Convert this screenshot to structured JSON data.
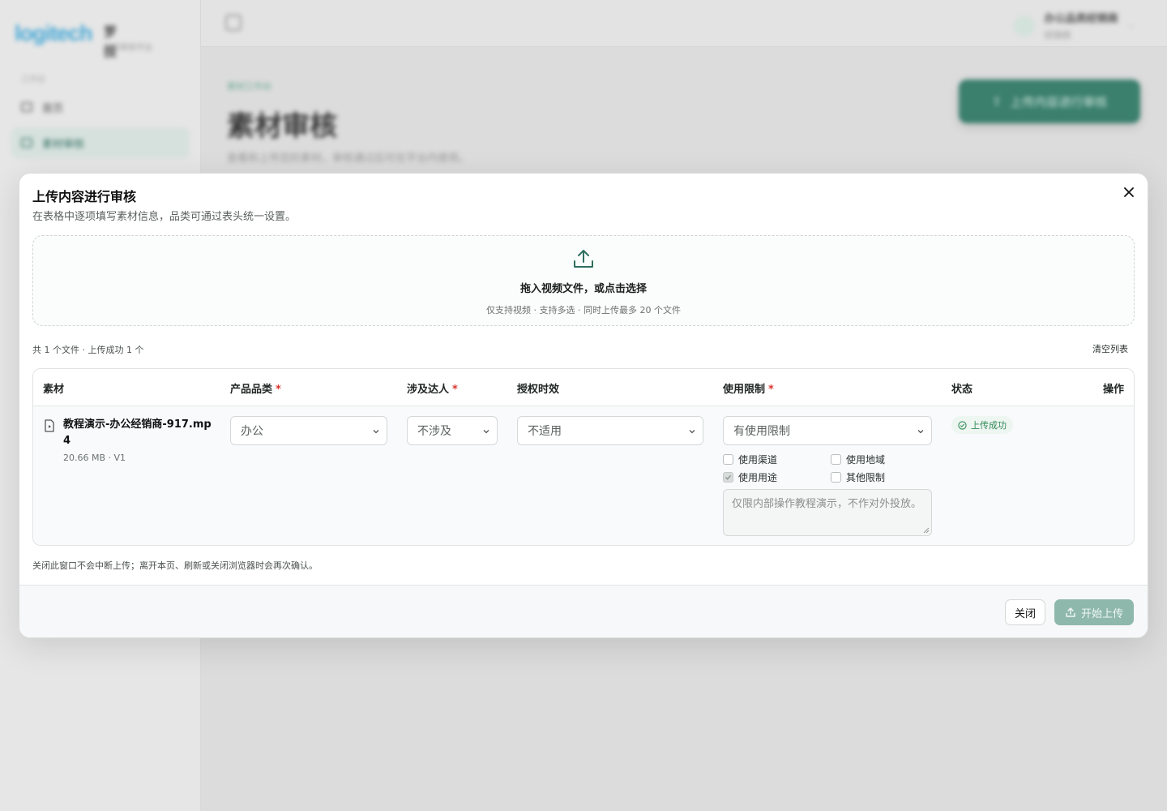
{
  "background": {
    "logo": "logitech",
    "brand": "罗 技",
    "brand_sub": "内容审核平台",
    "nav_group": "工作台",
    "nav": [
      {
        "label": "首页"
      },
      {
        "label": "素材审核"
      }
    ],
    "user_name": "办公品类经销商",
    "user_role": "经销商",
    "breadcrumb": "素材工作台",
    "page_title": "素材审核",
    "page_desc": "查看和上传您的素材，审核通过后可在平台内使用。",
    "cta_label": "上传内容进行审核"
  },
  "modal": {
    "title": "上传内容进行审核",
    "subtitle": "在表格中逐项填写素材信息，品类可通过表头统一设置。",
    "dropzone": {
      "title": "拖入视频文件，或点击选择",
      "hint": "仅支持视频 · 支持多选 · 同时上传最多 20 个文件"
    },
    "summary": "共 1 个文件 · 上传成功 1 个",
    "clear_label": "清空列表",
    "columns": {
      "material": "素材",
      "category": "产品品类",
      "influencer": "涉及达人",
      "auth": "授权时效",
      "restriction": "使用限制",
      "status": "状态",
      "actions": "操作"
    },
    "required_mark": "*",
    "row": {
      "file_name": "教程演示-办公经销商-917.mp4",
      "file_meta": "20.66 MB · V1",
      "category": "办公",
      "influencer": "不涉及",
      "auth": "不适用",
      "restriction": "有使用限制",
      "checkboxes": [
        {
          "label": "使用渠道",
          "checked": false
        },
        {
          "label": "使用地域",
          "checked": false
        },
        {
          "label": "使用用途",
          "checked": true
        },
        {
          "label": "其他限制",
          "checked": false
        }
      ],
      "restriction_note": "仅限内部操作教程演示，不作对外投放。",
      "status": "上传成功"
    },
    "footnote": "关闭此窗口不会中断上传；离开本页、刷新或关闭浏览器时会再次确认。",
    "close_label": "关闭",
    "upload_label": "开始上传"
  },
  "colors": {
    "accent": "#3b7f6d",
    "success": "#2f8a58",
    "required": "#d9342b",
    "upload_disabled": "#8fb8ac"
  }
}
